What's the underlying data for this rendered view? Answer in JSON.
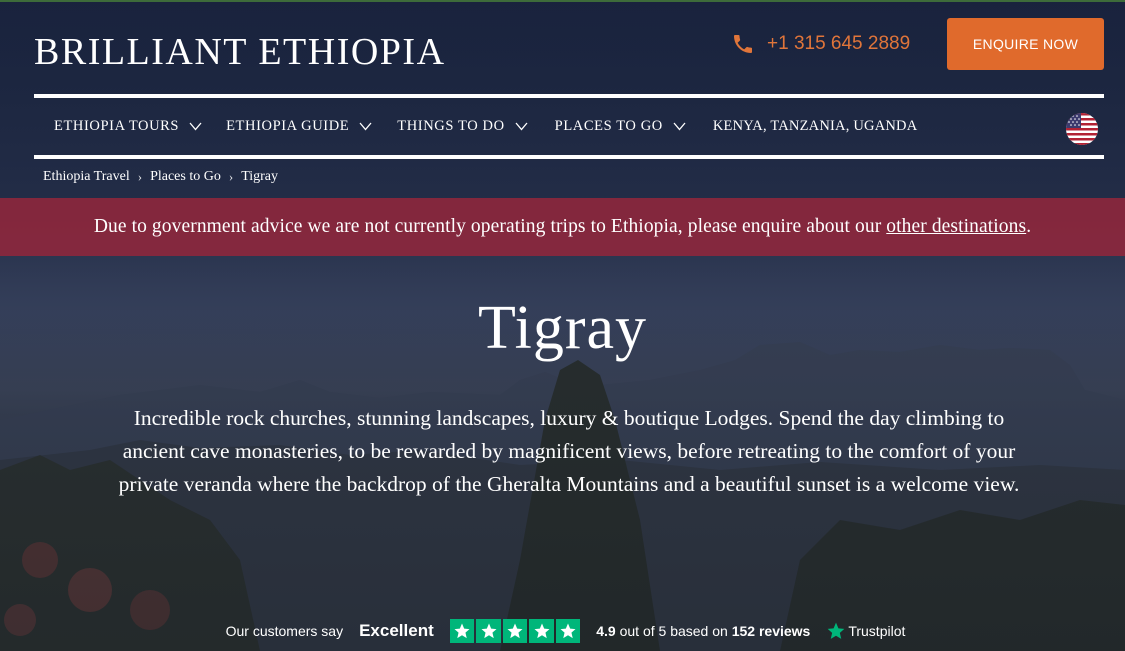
{
  "header": {
    "logo": "BRILLIANT ETHIOPIA",
    "phone": "+1 315 645 2889",
    "enquire_label": "ENQUIRE NOW"
  },
  "nav": {
    "items": [
      {
        "label": "ETHIOPIA TOURS",
        "dropdown": true
      },
      {
        "label": "ETHIOPIA GUIDE",
        "dropdown": true
      },
      {
        "label": "THINGS TO DO",
        "dropdown": true
      },
      {
        "label": "PLACES TO GO",
        "dropdown": true
      },
      {
        "label": "KENYA, TANZANIA, UGANDA",
        "dropdown": false
      }
    ],
    "flag_icon": "us-flag-icon"
  },
  "breadcrumb": {
    "items": [
      "Ethiopia Travel",
      "Places to Go",
      "Tigray"
    ],
    "separator": "›"
  },
  "alert": {
    "text": "Due to government advice we are not currently operating trips to Ethiopia, please enquire about our",
    "link": "other destinations",
    "suffix": "."
  },
  "hero": {
    "title": "Tigray",
    "description": "Incredible rock churches, stunning landscapes, luxury & boutique Lodges. Spend the day climbing to ancient cave monasteries, to be rewarded by magnificent views, before retreating to the comfort of your private veranda where the backdrop of the Gheralta Mountains and a beautiful sunset is a welcome view."
  },
  "trustpilot": {
    "intro": "Our customers say",
    "rating_word": "Excellent",
    "stars": 5,
    "score": "4.9",
    "score_text_1": "out of 5 based on",
    "review_count": "152",
    "review_word": "reviews",
    "brand": "Trustpilot"
  },
  "colors": {
    "accent_orange": "#e06a2c",
    "phone_orange": "#e0753a",
    "alert_red": "#98263a",
    "trustpilot_green": "#00b67a"
  }
}
